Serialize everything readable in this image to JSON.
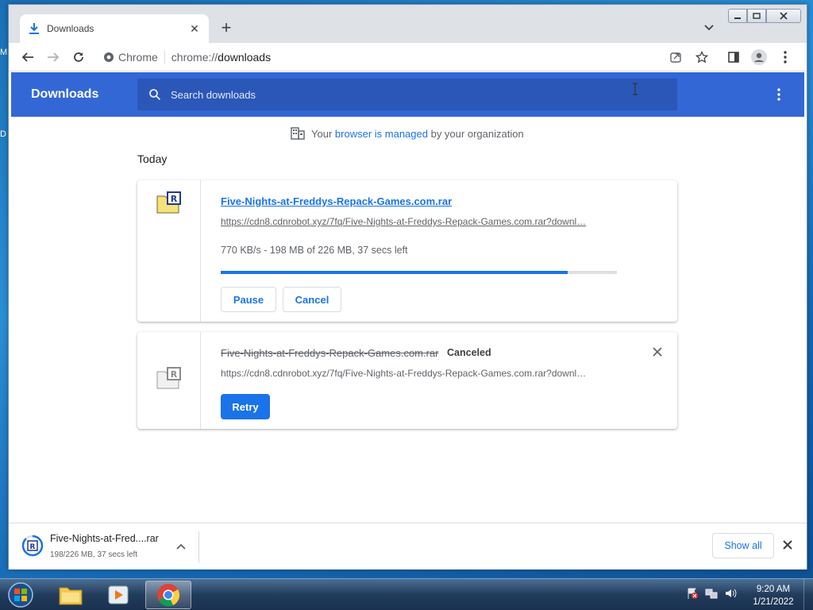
{
  "desktop": {
    "left_text_1": "M",
    "left_text_2": "D"
  },
  "browser": {
    "tab_title": "Downloads",
    "omnibox_site": "Chrome",
    "omnibox_url_scheme": "chrome://",
    "omnibox_url_path": "downloads"
  },
  "downloads": {
    "header_title": "Downloads",
    "search_placeholder": "Search downloads",
    "managed_prefix": "Your",
    "managed_link": "browser is managed",
    "managed_suffix": "by your organization",
    "section_label": "Today",
    "items": [
      {
        "filename": "Five-Nights-at-Freddys-Repack-Games.com.rar",
        "source": "https://cdn8.cdnrobot.xyz/7fq/Five-Nights-at-Freddys-Repack-Games.com.rar?downl…",
        "status": "770 KB/s - 198 MB of 226 MB, 37 secs left",
        "progress": 0.876,
        "pause_label": "Pause",
        "cancel_label": "Cancel"
      },
      {
        "filename": "Five-Nights-at-Freddys-Repack-Games.com.rar",
        "state_label": "Canceled",
        "source": "https://cdn8.cdnrobot.xyz/7fq/Five-Nights-at-Freddys-Repack-Games.com.rar?downl…",
        "retry_label": "Retry"
      }
    ]
  },
  "shelf": {
    "item_name": "Five-Nights-at-Fred....rar",
    "item_sub": "198/226 MB, 37 secs left",
    "show_all_label": "Show all"
  },
  "taskbar": {
    "time": "9:20 AM",
    "date": "1/21/2022"
  },
  "colors": {
    "accent": "#1a73e8",
    "header": "#3367d6"
  }
}
